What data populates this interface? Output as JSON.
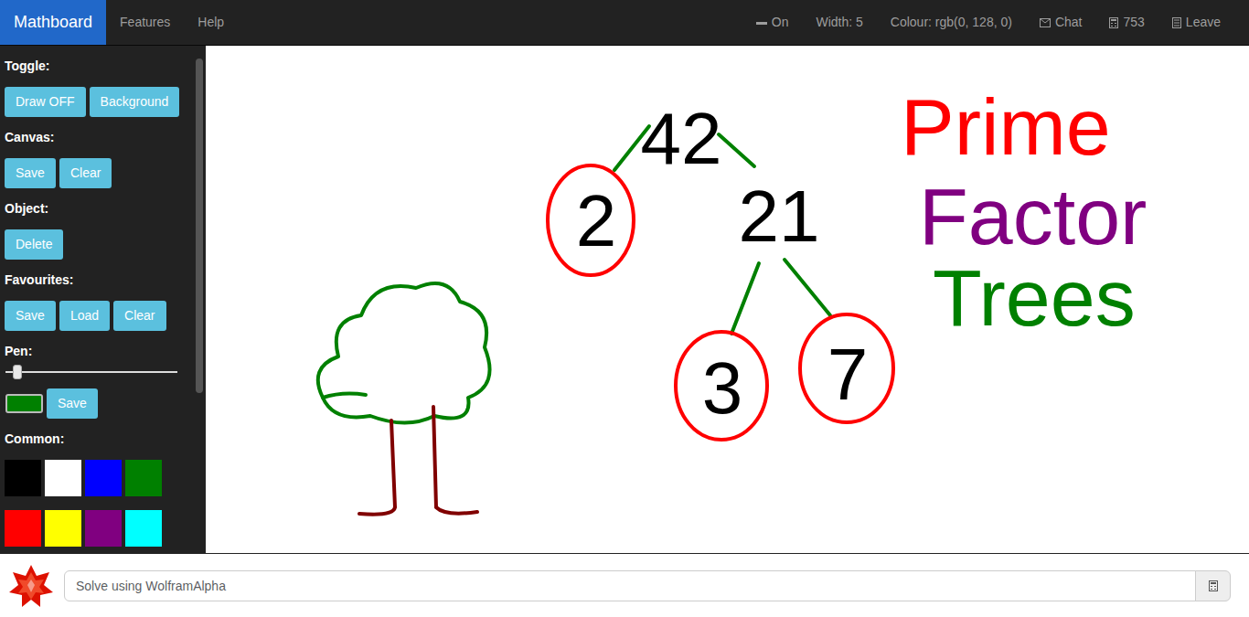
{
  "navbar": {
    "brand": "Mathboard",
    "links": [
      "Features",
      "Help"
    ],
    "status": [
      {
        "kind": "pen",
        "label": "On"
      },
      {
        "kind": "text",
        "label": "Width: 5"
      },
      {
        "kind": "text",
        "label": "Colour: rgb(0, 128, 0)"
      },
      {
        "kind": "chat",
        "label": "Chat"
      },
      {
        "kind": "calc",
        "label": "753"
      },
      {
        "kind": "leave",
        "label": "Leave"
      }
    ]
  },
  "sidebar": {
    "scroll_level": 0.66,
    "sections": [
      {
        "kind": "buttons",
        "heading": "Toggle:",
        "buttons": [
          "Draw OFF",
          "Background"
        ]
      },
      {
        "kind": "buttons",
        "heading": "Canvas:",
        "buttons": [
          "Save",
          "Clear"
        ]
      },
      {
        "kind": "buttons",
        "heading": "Object:",
        "buttons": [
          "Delete"
        ]
      },
      {
        "kind": "buttons",
        "heading": "Favourites:",
        "buttons": [
          "Save",
          "Load",
          "Clear"
        ]
      },
      {
        "kind": "pen",
        "heading": "Pen:",
        "level": 0.07,
        "color": "#008000",
        "button": "Save"
      },
      {
        "kind": "palette",
        "heading": "Common:",
        "colors": [
          "#000000",
          "#ffffff",
          "#0000ff",
          "#008000",
          "#ff0000",
          "#ffff00",
          "#800080",
          "#00ffff"
        ]
      }
    ]
  },
  "canvas": {
    "nodes": [
      {
        "text": "42",
        "circled": false
      },
      {
        "text": "2",
        "circled": true
      },
      {
        "text": "21",
        "circled": false
      },
      {
        "text": "3",
        "circled": true
      },
      {
        "text": "7",
        "circled": true
      }
    ],
    "title": [
      {
        "text": "Prime",
        "color": "#ff0000"
      },
      {
        "text": "Factor",
        "color": "#800080"
      },
      {
        "text": "Trees",
        "color": "#008000"
      }
    ]
  },
  "wolfram": {
    "placeholder": "Solve using WolframAlpha"
  }
}
